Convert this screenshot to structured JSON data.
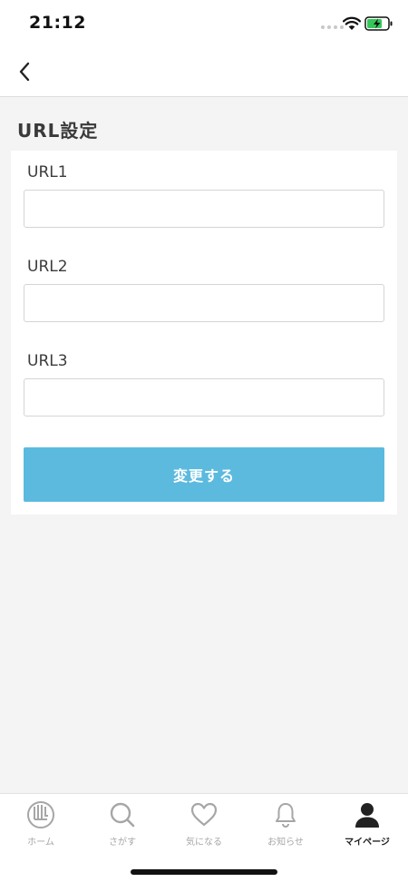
{
  "status_bar": {
    "time": "21:12"
  },
  "header": {
    "back_icon": "chevron-left-icon"
  },
  "page": {
    "title": "URL設定"
  },
  "form": {
    "fields": [
      {
        "label": "URL1",
        "value": "",
        "placeholder": ""
      },
      {
        "label": "URL2",
        "value": "",
        "placeholder": ""
      },
      {
        "label": "URL3",
        "value": "",
        "placeholder": ""
      }
    ],
    "submit_label": "変更する"
  },
  "tab_bar": {
    "items": [
      {
        "label": "ホーム",
        "icon": "home-icon",
        "active": false
      },
      {
        "label": "さがす",
        "icon": "search-icon",
        "active": false
      },
      {
        "label": "気になる",
        "icon": "heart-icon",
        "active": false
      },
      {
        "label": "お知らせ",
        "icon": "bell-icon",
        "active": false
      },
      {
        "label": "マイページ",
        "icon": "person-icon",
        "active": true
      }
    ]
  },
  "colors": {
    "accent": "#5bbade",
    "background": "#f4f4f4",
    "inactive_tab": "#a6a6a6",
    "active_tab": "#222222"
  }
}
